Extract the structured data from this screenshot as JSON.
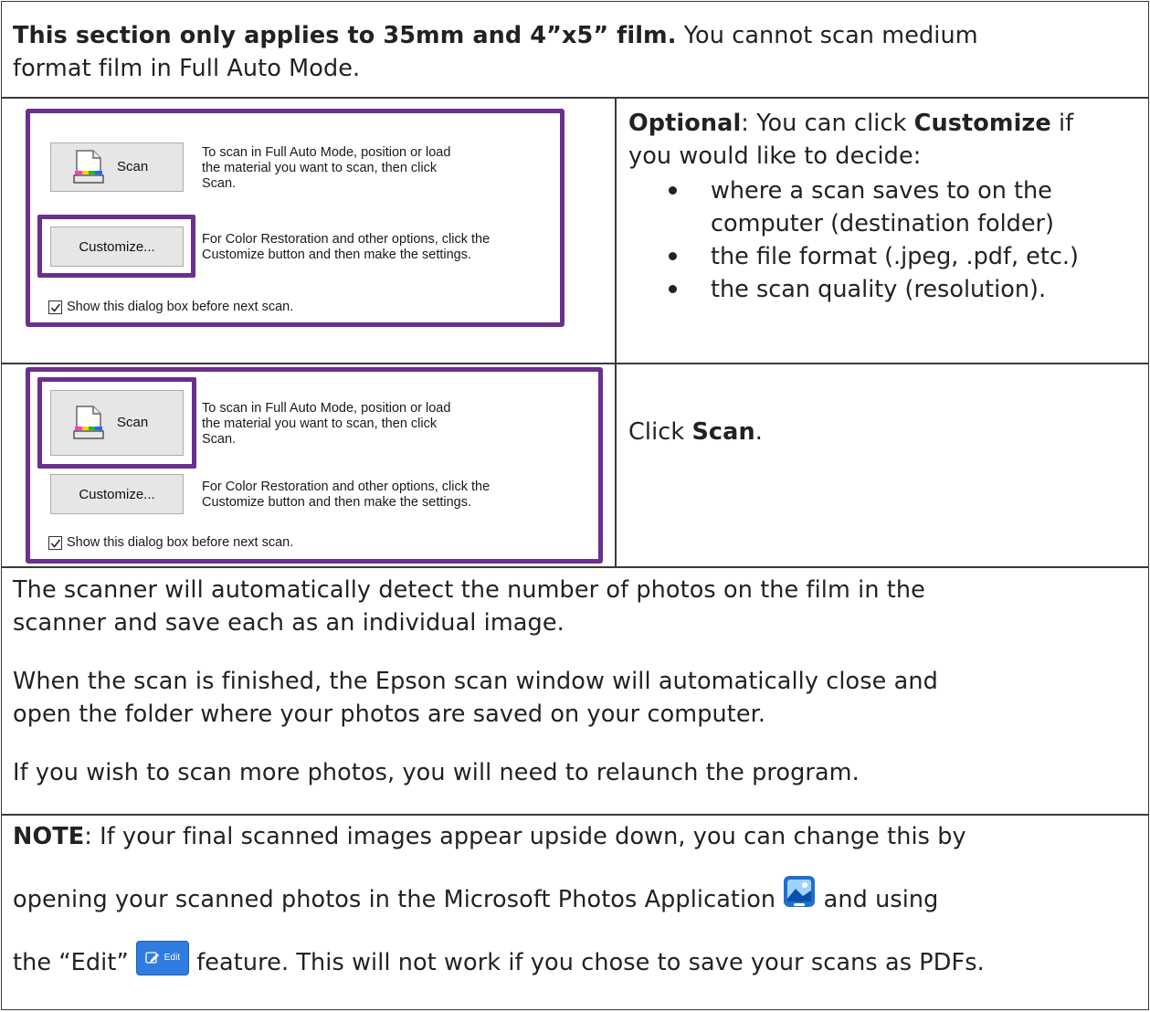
{
  "intro": {
    "bold": "This section only applies to 35mm and 4”x5” film.",
    "rest_line1": " You cannot scan medium",
    "rest_line2": "format film in Full Auto Mode."
  },
  "dialog": {
    "scan_label": "Scan",
    "scan_text": [
      "To scan in Full Auto Mode, position or load",
      "the material you want to scan, then click",
      "Scan."
    ],
    "customize_label": "Customize...",
    "customize_text": [
      "For Color Restoration and other options, click the",
      "Customize button and then make the settings."
    ],
    "checkbox_label": "Show this dialog box before next scan."
  },
  "row1": {
    "optional_bold": "Optional",
    "optional_rest": ": You can click ",
    "customize_bold": "Customize",
    "optional_tail": " if",
    "line2": "you would like to decide:",
    "bullets": [
      [
        "where a scan saves to on the",
        "computer (destination folder)"
      ],
      [
        "the file format (.jpeg, .pdf, etc.)"
      ],
      [
        "the scan quality (resolution)."
      ]
    ]
  },
  "row2": {
    "click": "Click ",
    "scan_bold": "Scan",
    "period": "."
  },
  "info": {
    "p1_line1": "The scanner will automatically detect the number of photos on the film in the",
    "p1_line2": "scanner and save each as an individual image.",
    "p2_line1": "When the scan is finished, the Epson scan window will automatically close and",
    "p2_line2": "open the folder where your photos are saved on your computer.",
    "p3": "If you wish to scan more photos, you will need to relaunch the program."
  },
  "note": {
    "bold": "NOTE",
    "line1_rest": ": If your final scanned images appear upside down, you can change this by",
    "line2_a": "opening your scanned photos in the Microsoft Photos Application",
    "line2_b": " and using",
    "line3_a": "the “Edit”",
    "edit_button_label": "Edit",
    "line3_b": " feature. This will not work if you chose to save your scans as PDFs."
  },
  "colors": {
    "highlight": "#6b2f8c",
    "photos_icon": "#1e6fd0",
    "edit_button": "#2f7de1"
  }
}
